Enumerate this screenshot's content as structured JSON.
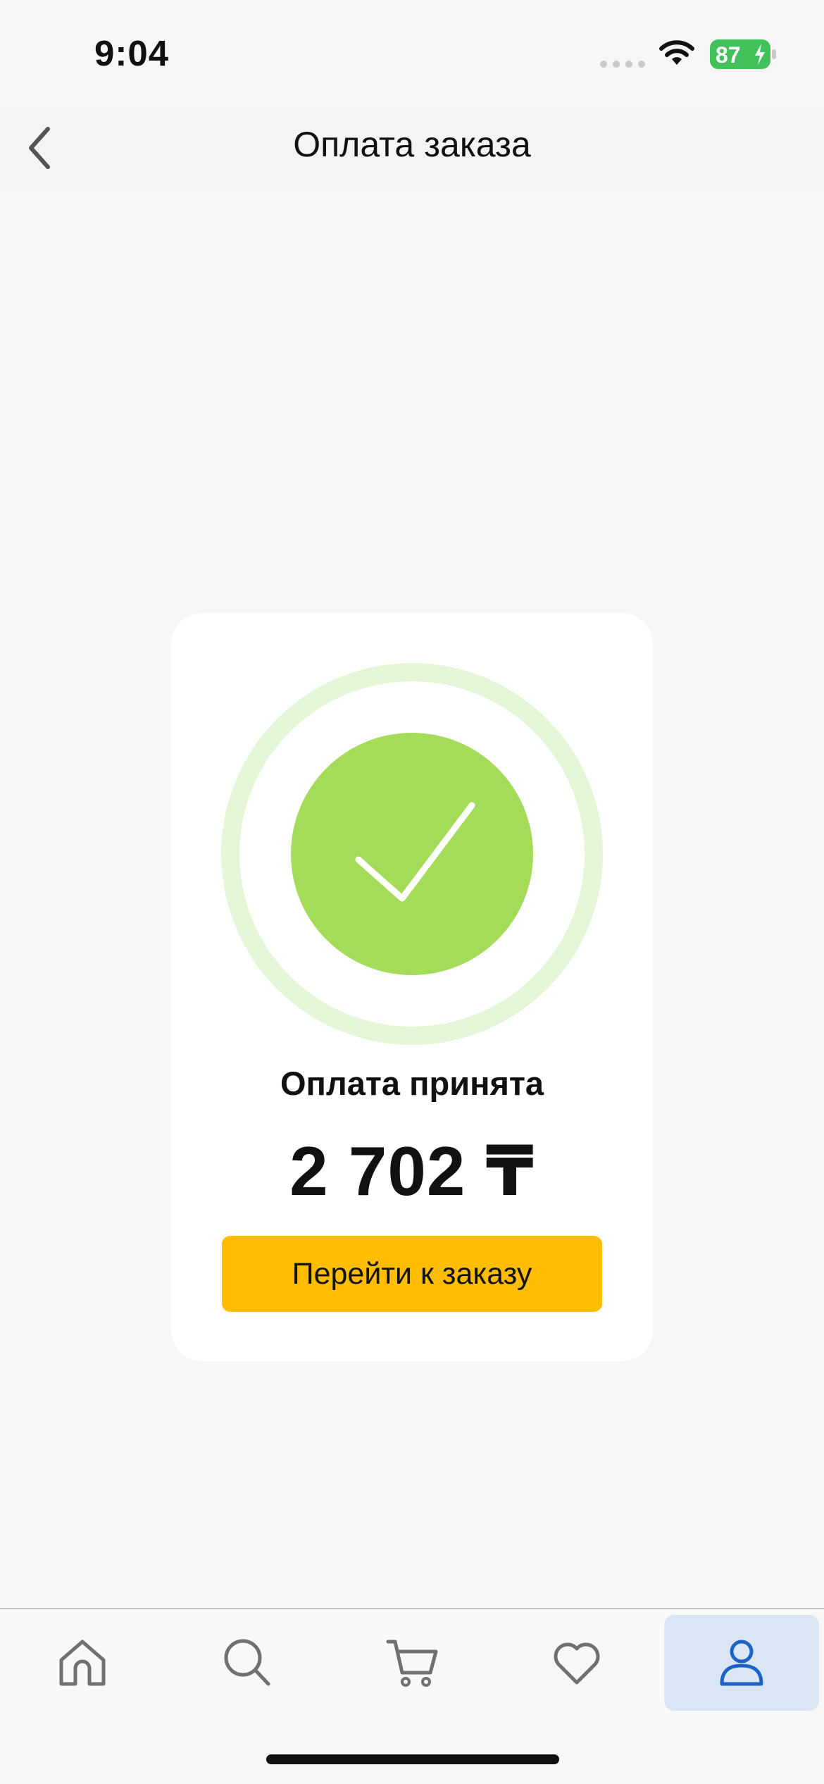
{
  "status_bar": {
    "time": "9:04",
    "battery_level": "87",
    "icons": [
      "signal-dots-icon",
      "wifi-icon",
      "battery-charging-icon"
    ]
  },
  "nav": {
    "title": "Оплата заказа",
    "back_icon": "chevron-left-icon"
  },
  "payment": {
    "status_text": "Оплата принята",
    "amount": "2 702 ₸",
    "button_label": "Перейти к заказу",
    "success_icon": "checkmark-circle-icon"
  },
  "tab_bar": {
    "items": [
      {
        "icon": "home-icon",
        "active": false
      },
      {
        "icon": "search-icon",
        "active": false
      },
      {
        "icon": "cart-icon",
        "active": false
      },
      {
        "icon": "heart-icon",
        "active": false
      },
      {
        "icon": "profile-icon",
        "active": true
      }
    ]
  },
  "colors": {
    "accent_button": "#ffbd00",
    "success_green": "#a4dc5a",
    "success_ring": "#e6f6d8",
    "active_tab_bg": "#dbe6f5",
    "active_tab_icon": "#1b63c9",
    "inactive_tab_icon": "#707070"
  }
}
